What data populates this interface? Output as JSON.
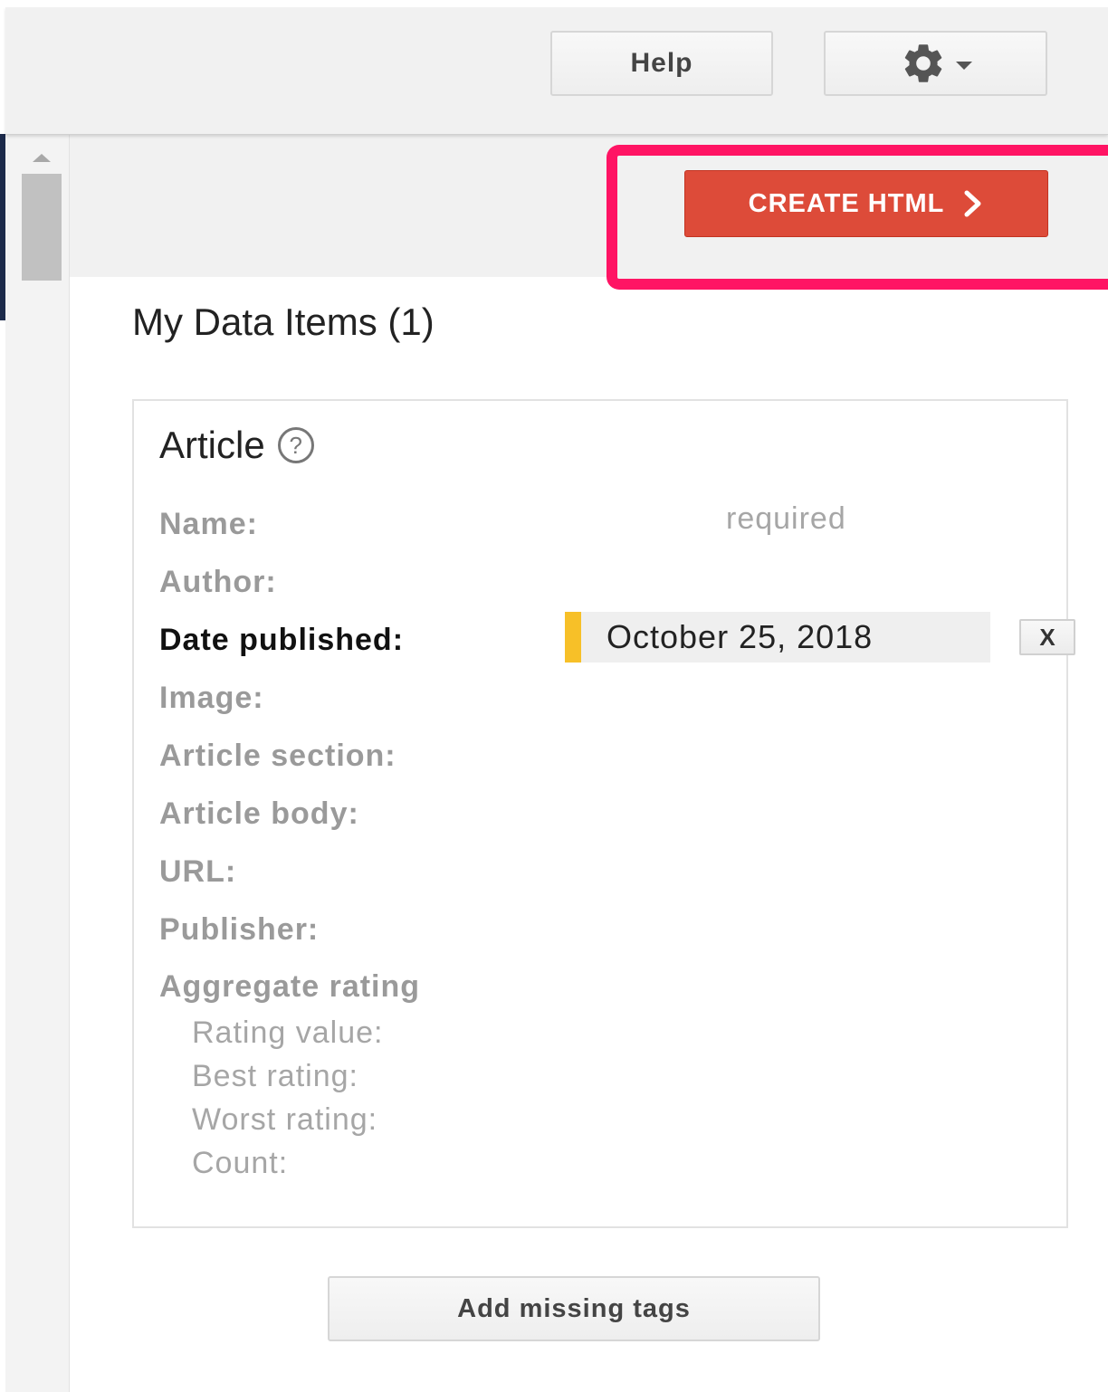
{
  "header": {
    "help_label": "Help",
    "settings_icon": "gear-icon",
    "dropdown_icon": "caret-down-icon"
  },
  "toolbar": {
    "create_html_label": "CREATE HTML",
    "create_html_icon": "chevron-right-icon",
    "highlight_color": "#ff1464",
    "button_color": "#dd4b39"
  },
  "main": {
    "section_title": "My Data Items (1)",
    "item": {
      "type_title": "Article",
      "help_icon": "question-circle-icon",
      "required_hint": "required",
      "fields": {
        "name": "Name:",
        "author": "Author:",
        "date_published": "Date published:",
        "image": "Image:",
        "article_section": "Article section:",
        "article_body": "Article body:",
        "url": "URL:",
        "publisher": "Publisher:",
        "aggregate_rating": "Aggregate rating"
      },
      "rating_fields": {
        "rating_value": "Rating value:",
        "best_rating": "Best rating:",
        "worst_rating": "Worst rating:",
        "count": "Count:"
      },
      "date_published_value": "October 25, 2018",
      "tag_marker_color": "#f7c028",
      "remove_label": "X"
    },
    "add_missing_tags_label": "Add missing tags"
  }
}
